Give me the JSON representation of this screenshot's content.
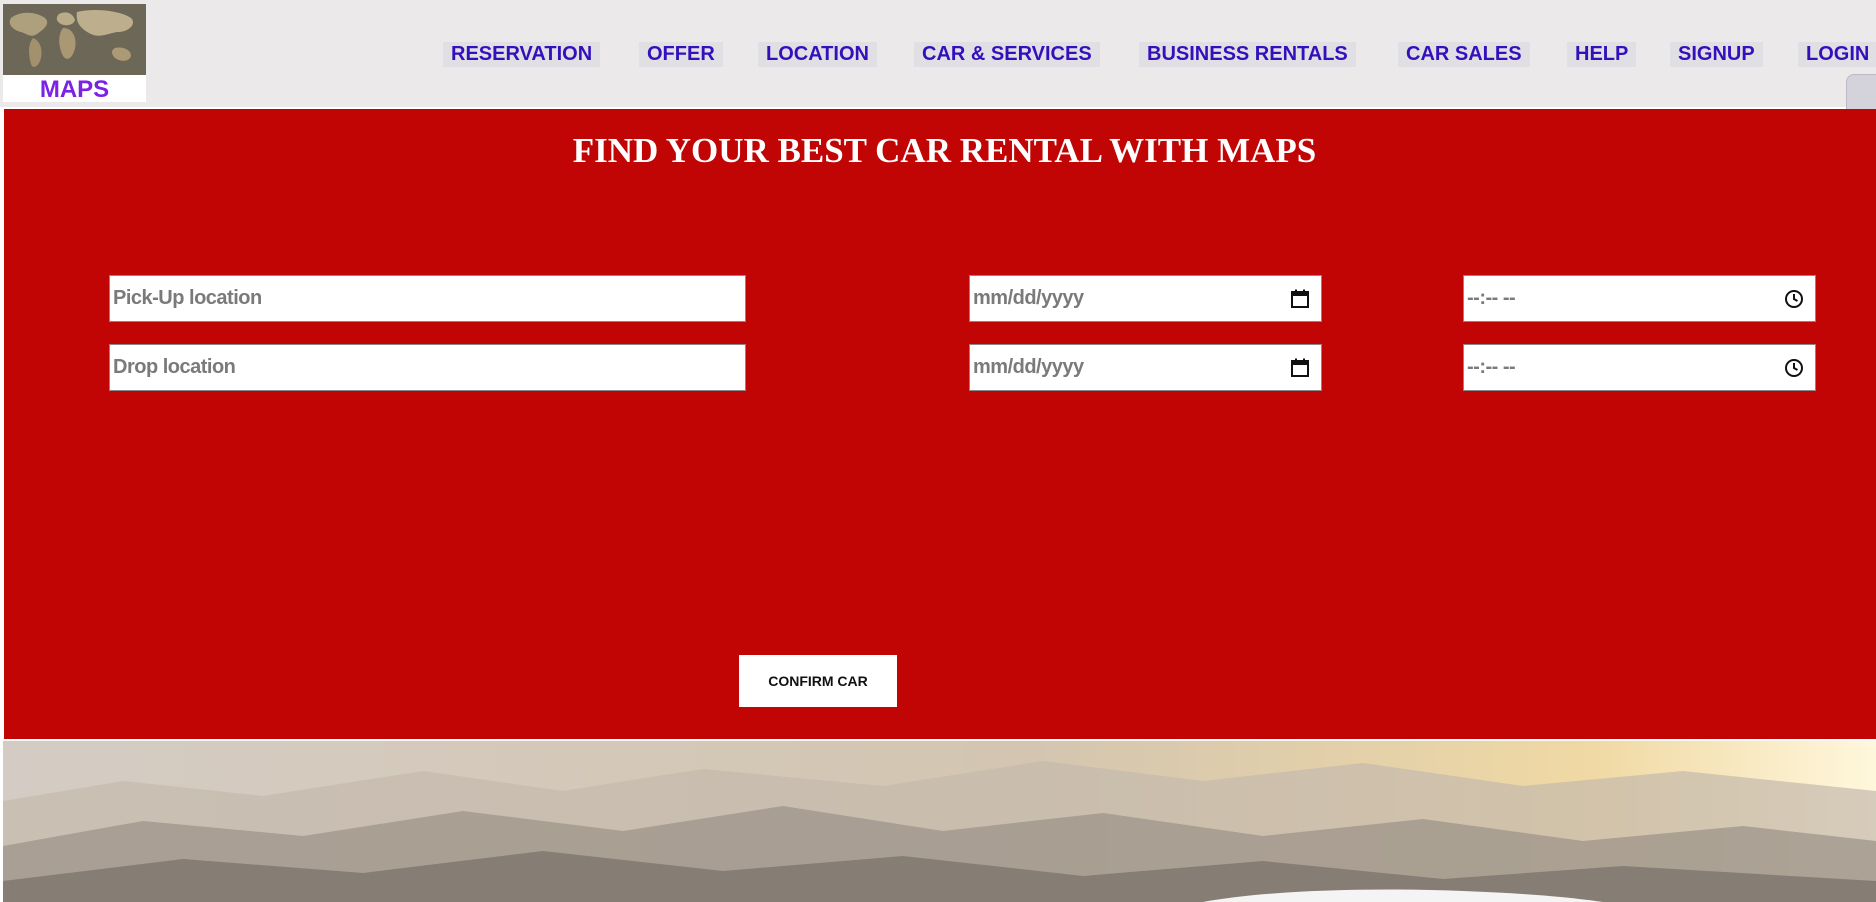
{
  "logo": {
    "text": "MAPS"
  },
  "nav": {
    "items": [
      "RESERVATION",
      "OFFER",
      "LOCATION",
      "CAR & SERVICES",
      "BUSINESS RENTALS",
      "CAR SALES",
      "HELP",
      "SIGNUP",
      "LOGIN"
    ]
  },
  "hero": {
    "title": "FIND YOUR BEST CAR RENTAL WITH MAPS"
  },
  "form": {
    "pickup_placeholder": "Pick-Up location",
    "drop_placeholder": "Drop location",
    "pickup_date": "mm/dd/yyyy",
    "drop_date": "mm/dd/yyyy",
    "pickup_time": "--:-- --",
    "drop_time": "--:-- --",
    "confirm_label": "CONFIRM CAR"
  },
  "icons": {
    "date": "calendar-icon",
    "time": "clock-icon"
  },
  "colors": {
    "hero_bg": "#c10404",
    "nav_text": "#3410bd",
    "logo_text": "#7a22e6",
    "topbar_bg": "#ebe9e9"
  }
}
